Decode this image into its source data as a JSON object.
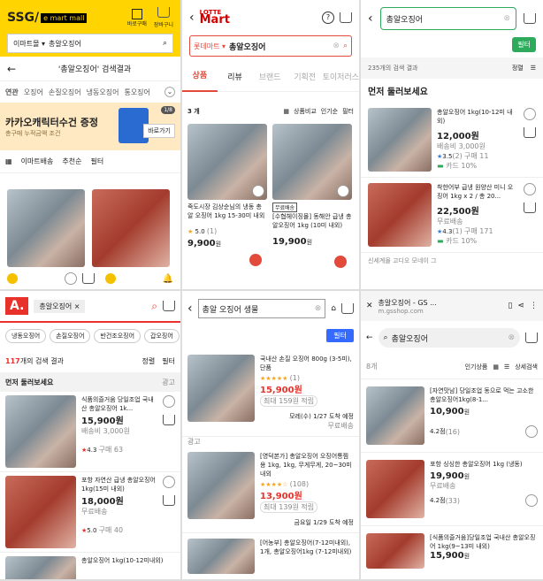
{
  "p1": {
    "brand": "SSG/",
    "brand2": "e mart mall",
    "icon1": "바로구매",
    "icon2": "장바구니",
    "store": "이마트몰 ▾",
    "search": "총알오징어",
    "result_title": "'총알오징어' 검색결과",
    "tag_label": "연관",
    "tags": [
      "오징어",
      "손질오징어",
      "냉동오징어",
      "통오징어"
    ],
    "banner_title": "카카오캐릭터수건 증정",
    "banner_sub": "총구매 누적금액 조건",
    "banner_btn": "바로가기",
    "banner_page": "1/8",
    "filter_items": [
      "이마트배송",
      "추천순",
      "필터"
    ]
  },
  "p2": {
    "logo_top": "LOTTE",
    "logo": "Mart",
    "search": "총알오징어",
    "store": "롯데마트 ▾",
    "tabs": [
      "상품",
      "리뷰",
      "브랜드",
      "기획전",
      "토이저러스"
    ],
    "count": "3 개",
    "sort": "상품비교",
    "sort2": "인기순",
    "sort3": "필터",
    "items": [
      {
        "title": "죽도시장 김상순님의 냉동 총알 오징어 1kg 15-30미 내외",
        "rating": "5.0",
        "reviews": "(1)",
        "price": "9,900",
        "unit": "원"
      },
      {
        "badge": "무료배송",
        "title": "[수협헤이징몰] 동해안 급냉 총알오징어 1kg (10미 내외)",
        "price": "19,900",
        "unit": "원"
      }
    ]
  },
  "p3": {
    "search": "총알오징어",
    "filter": "필터",
    "count": "235개의 검색 결과",
    "sort": "정렬",
    "section": "먼저 둘러보세요",
    "items": [
      {
        "title": "총알오징어 1kg(10-12미 내외)",
        "price": "12,000원",
        "ship": "배송비 3,000원",
        "rating": "3.5",
        "reviews": "(2)",
        "buy": "구매 11",
        "card": "카드 10%"
      },
      {
        "title": "착한어부 급냉 원양산 미니 오징어 1kg x 2 / 총 20...",
        "price": "22,500원",
        "ship": "무료배송",
        "rating": "4.3",
        "reviews": "(1)",
        "buy": "구매 171",
        "card": "카드 10%"
      }
    ],
    "more": "신세계몰 고디오 모네이 그"
  },
  "p4": {
    "logo": "A.",
    "chip": "총알오징어",
    "chips": [
      "냉동오징어",
      "손질오징어",
      "반건조오징어",
      "갑오징어"
    ],
    "count": "117",
    "count_suffix": "개의 검색 결과",
    "sort": "정렬",
    "filter": "필터",
    "section": "먼저 둘러보세요",
    "ad": "광고",
    "items": [
      {
        "title": "식품의즐거움 당일조업 국내산 총알오징어 1k...",
        "price": "15,900원",
        "ship": "배송비 3,000원",
        "rating": "4.3",
        "buy": "구매 63"
      },
      {
        "title": "포항 자연산 급냉 총알오징어 1kg(15미 내외)",
        "price": "18,000원",
        "ship": "무료배송",
        "rating": "5.0",
        "buy": "구매 40"
      },
      {
        "title": "총알오징어 1kg(10-12미내외)",
        "price": ""
      }
    ]
  },
  "p5": {
    "search": "총알 오징어 생물",
    "filter": "필터",
    "items": [
      {
        "title": "국내산 손질 오징어 800g (3-5미), 단품",
        "reviews": "(1)",
        "price": "15,900원",
        "reward": "최대 159원 적립",
        "delivery": "모레(수) 1/27 도착 예정",
        "free": "무료배송",
        "ad": "광고"
      },
      {
        "title": "[영덕본가] 총알오징어 오징어통찜용 1kg, 1kg, 무게무게, 20~30미내외",
        "reviews": "(108)",
        "price": "13,900원",
        "reward": "최대 139원 적립",
        "delivery": "금요일 1/29 도착 예정"
      },
      {
        "title": "[어농부] 총알오징어(7-12미내외), 1개, 총알오징어1kg (7-12미내외)",
        "price": ""
      }
    ]
  },
  "p6": {
    "tab_title": "총알오징어 - GS ...",
    "tab_url": "m.gsshop.com",
    "search": "총알오징어",
    "count": "8개",
    "sort": "인기상품",
    "detail": "상세검색",
    "items": [
      {
        "title": "[자연맛남] 당일조업 동으로 먹는 고소한 총알오징어1kg(8-1...",
        "price": "10,900",
        "unit": "원",
        "rating": "4.2점",
        "reviews": "(16)"
      },
      {
        "title": "포항 싱싱한 총알오징어 1kg (냉동)",
        "price": "19,900",
        "unit": "원",
        "ship": "무료배송",
        "rating": "4.2점",
        "reviews": "(33)"
      },
      {
        "title": "[식품의즐거움]당일조업 국내산 총알오징어 1kg(9~13미 내외)",
        "price": "15,900",
        "unit": "원"
      }
    ]
  }
}
